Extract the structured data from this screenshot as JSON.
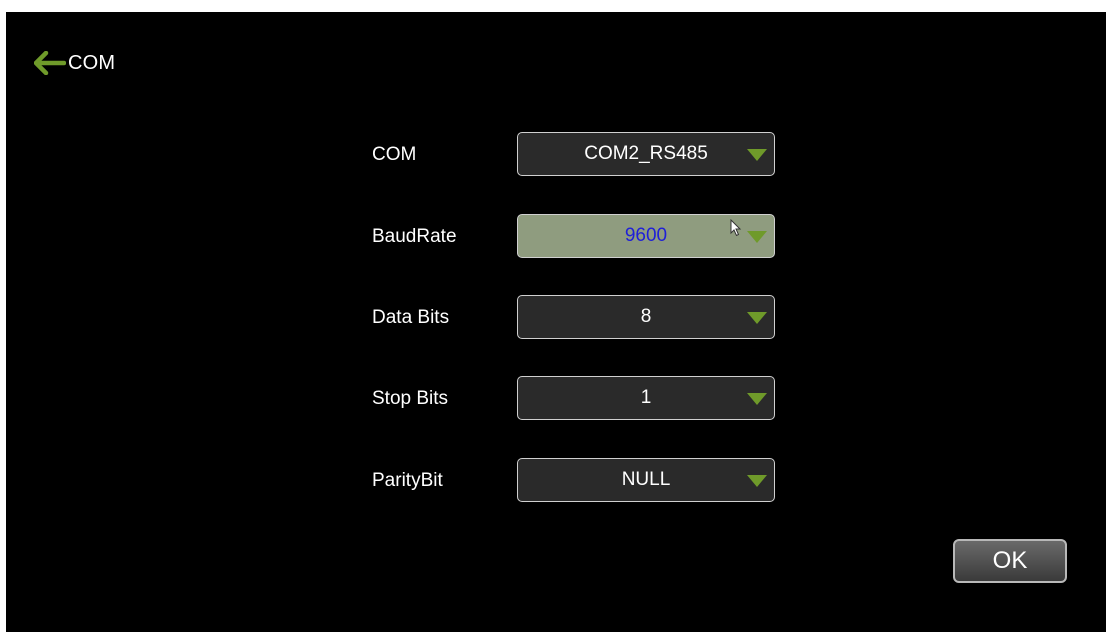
{
  "header": {
    "back_icon": "arrow-left-icon",
    "title": "COM"
  },
  "colors": {
    "background": "#000000",
    "accent_green": "#6f9a2a",
    "active_field": "#8f9c7f",
    "active_text": "#1f1fd8",
    "text": "#ffffff"
  },
  "settings": {
    "com": {
      "label": "COM",
      "value": "COM2_RS485"
    },
    "baudrate": {
      "label": "BaudRate",
      "value": "9600",
      "focused": true
    },
    "data_bits": {
      "label": "Data Bits",
      "value": "8"
    },
    "stop_bits": {
      "label": "Stop Bits",
      "value": "1"
    },
    "parity_bit": {
      "label": "ParityBit",
      "value": "NULL"
    }
  },
  "footer": {
    "ok_label": "OK"
  }
}
